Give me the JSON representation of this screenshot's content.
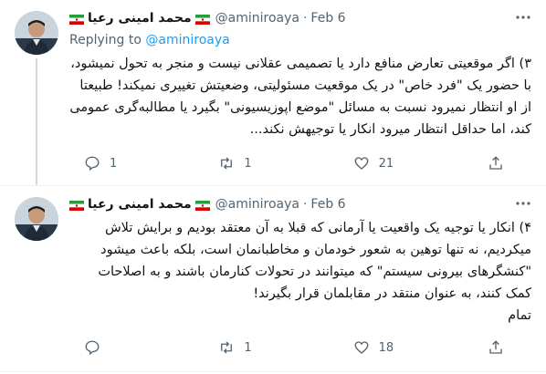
{
  "tweets": [
    {
      "author_name": "محمد امینی رعیا",
      "handle": "@aminiroaya",
      "date": "Feb 6",
      "replying_prefix": "Replying to",
      "replying_to": "@aminiroaya",
      "text": "۳) اگر موقعیتی تعارض منافع دارد یا تصمیمی عقلانی نیست و منجر به تحول نمیشود، با حضور یک \"فرد خاص\" در یک موقعیت مسئولیتی، وضعیتش تغییری نمیکند! طبیعتا از او انتظار نمیرود نسبت به مسائل \"موضع اپوزیسیونی\" بگیرد یا مطالبه‌گری عمومی کند، اما حداقل انتظار میرود انکار یا توجیهش نکند...",
      "actions": {
        "replies": "1",
        "retweets": "1",
        "likes": "21",
        "share": ""
      }
    },
    {
      "author_name": "محمد امینی رعیا",
      "handle": "@aminiroaya",
      "date": "Feb 6",
      "text": "۴) انکار یا توجیه یک واقعیت یا آرمانی که قبلا به آن معتقد بودیم و برایش تلاش میکردیم، نه تنها توهین به شعور خودمان و مخاطبانمان است، بلکه باعث میشود \"کنشگرهای بیرونی سیستم\" که میتوانند در تحولات کنارمان باشند و به اصلاحات کمک کنند، به عنوان منتقد در مقابلمان قرار بگیرند!\nتمام",
      "actions": {
        "replies": "",
        "retweets": "1",
        "likes": "18",
        "share": ""
      }
    }
  ],
  "icons": {
    "more": "more-horizontal-icon",
    "reply": "reply-icon",
    "retweet": "retweet-icon",
    "like": "heart-icon",
    "share": "share-icon",
    "flag": "iran-flag-emoji"
  },
  "colors": {
    "accent": "#1d9bf0",
    "muted": "#536471",
    "text": "#0f1419"
  }
}
